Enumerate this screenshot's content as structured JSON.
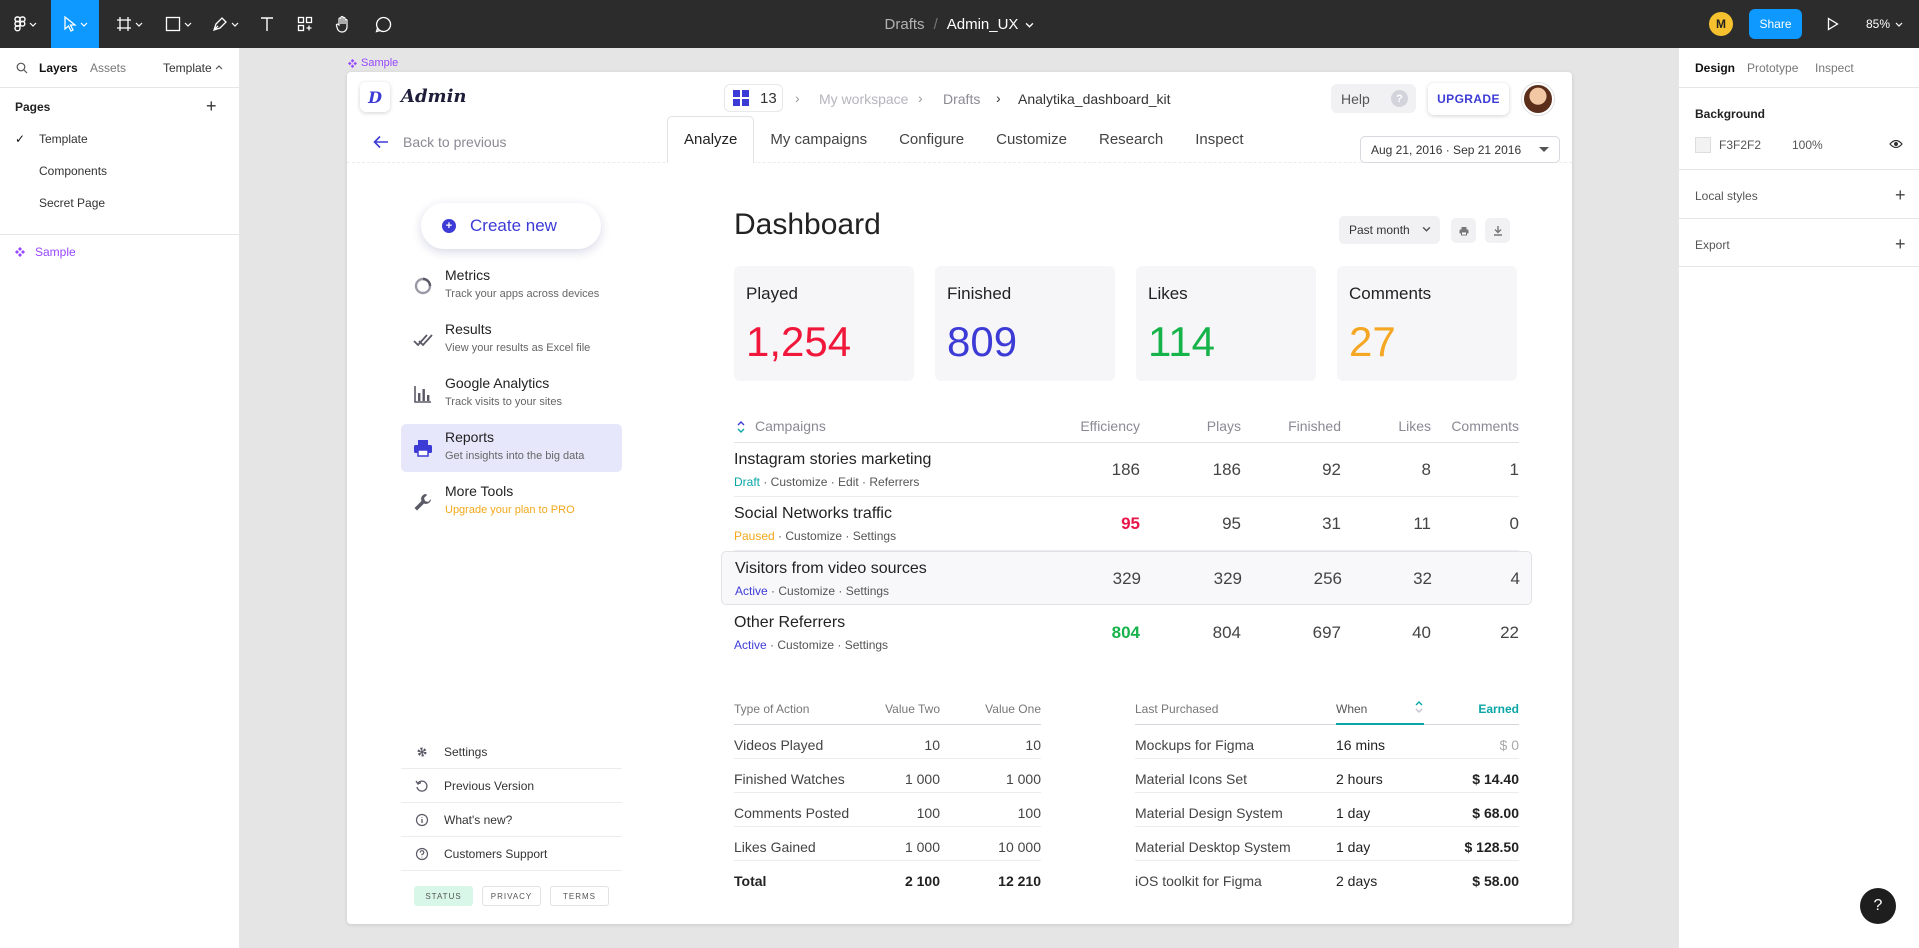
{
  "topbar": {
    "breadcrumb_project": "Drafts",
    "breadcrumb_sep": "/",
    "file_name": "Admin_UX",
    "user_initial": "M",
    "share_label": "Share",
    "zoom": "85%",
    "colors": {
      "bg": "#2c2c2c",
      "accent": "#0d99ff"
    }
  },
  "left_panel": {
    "tabs": [
      "Layers",
      "Assets",
      "Template"
    ],
    "pages_heading": "Pages",
    "pages": [
      "Template",
      "Components",
      "Secret Page"
    ],
    "current_page": "Template",
    "layers": [
      "Sample"
    ]
  },
  "right_panel": {
    "tabs": [
      "Design",
      "Prototype",
      "Inspect"
    ],
    "background_label": "Background",
    "background_hex": "F3F2F2",
    "background_opacity": "100%",
    "local_styles": "Local styles",
    "export": "Export"
  },
  "frame": {
    "name": "Sample",
    "app_name": "Admin",
    "logo_letter": "D",
    "workspace_count": "13",
    "breadcrumbs": [
      "My workspace",
      "Drafts",
      "Analytika_dashboard_kit"
    ],
    "help_label": "Help",
    "upgrade_label": "UPGRADE",
    "back_label": "Back to previous",
    "tabs": [
      "Analyze",
      "My campaigns",
      "Configure",
      "Customize",
      "Research",
      "Inspect"
    ],
    "active_tab": "Analyze",
    "date_range": "Aug 21, 2016 · Sep 21 2016",
    "create_label": "Create new",
    "nav": [
      {
        "title": "Metrics",
        "sub": "Track your apps across devices",
        "icon": "donut-icon"
      },
      {
        "title": "Results",
        "sub": "View your results as Excel file",
        "icon": "double-check-icon"
      },
      {
        "title": "Google Analytics",
        "sub": "Track visits to your sites",
        "icon": "bar-chart-icon"
      },
      {
        "title": "Reports",
        "sub": "Get insights into the big data",
        "icon": "printer-icon"
      },
      {
        "title": "More Tools",
        "sub": "Upgrade your plan to PRO",
        "icon": "wrench-icon"
      }
    ],
    "footer_links": [
      "Settings",
      "Previous Version",
      "What's new?",
      "Customers Support"
    ],
    "pills": [
      "STATUS",
      "PRIVACY",
      "TERMS"
    ],
    "dashboard_title": "Dashboard",
    "period": "Past month",
    "stats": [
      {
        "label": "Played",
        "value": "1,254",
        "color": "#f0173a"
      },
      {
        "label": "Finished",
        "value": "809",
        "color": "#3d3bd6"
      },
      {
        "label": "Likes",
        "value": "114",
        "color": "#16b34a"
      },
      {
        "label": "Comments",
        "value": "27",
        "color": "#f5a623"
      }
    ],
    "campaigns_table": {
      "headers": [
        "Campaigns",
        "Efficiency",
        "Plays",
        "Finished",
        "Likes",
        "Comments"
      ],
      "rows": [
        {
          "name": "Instagram stories marketing",
          "status": "Draft",
          "status_color": "#0aa6a6",
          "actions": " · Customize · Edit · Referrers",
          "efficiency": "186",
          "eff_color": "#444",
          "plays": "186",
          "finished": "92",
          "likes": "8",
          "comments": "1"
        },
        {
          "name": "Social Networks traffic",
          "status": "Paused",
          "status_color": "#f2a81a",
          "actions": " · Customize · Settings",
          "efficiency": "95",
          "eff_color": "#e8174a",
          "plays": "95",
          "finished": "31",
          "likes": "11",
          "comments": "0"
        },
        {
          "name": "Visitors from video sources",
          "status": "Active",
          "status_color": "#3d3bd6",
          "actions": " · Customize · Settings",
          "efficiency": "329",
          "eff_color": "#444",
          "plays": "329",
          "finished": "256",
          "likes": "32",
          "comments": "4"
        },
        {
          "name": "Other Referrers",
          "status": "Active",
          "status_color": "#3d3bd6",
          "actions": " · Customize · Settings",
          "efficiency": "804",
          "eff_color": "#16b34a",
          "plays": "804",
          "finished": "697",
          "likes": "40",
          "comments": "22"
        }
      ]
    },
    "actions_table": {
      "headers": [
        "Type of Action",
        "Value Two",
        "Value One"
      ],
      "rows": [
        [
          "Videos Played",
          "10",
          "10"
        ],
        [
          "Finished Watches",
          "1 000",
          "1 000"
        ],
        [
          "Comments Posted",
          "100",
          "100"
        ],
        [
          "Likes Gained",
          "1 000",
          "10 000"
        ],
        [
          "Total",
          "2 100",
          "12 210"
        ]
      ]
    },
    "purchases_table": {
      "headers": [
        "Last Purchased",
        "When",
        "Earned"
      ],
      "rows": [
        [
          "Mockups for Figma",
          "16 mins",
          "$ 0"
        ],
        [
          "Material Icons Set",
          "2 hours",
          "$ 14.40"
        ],
        [
          "Material Design System",
          "1 day",
          "$ 68.00"
        ],
        [
          "Material Desktop System",
          "1 day",
          "$ 128.50"
        ],
        [
          "iOS toolkit for Figma",
          "2 days",
          "$ 58.00"
        ]
      ]
    }
  }
}
